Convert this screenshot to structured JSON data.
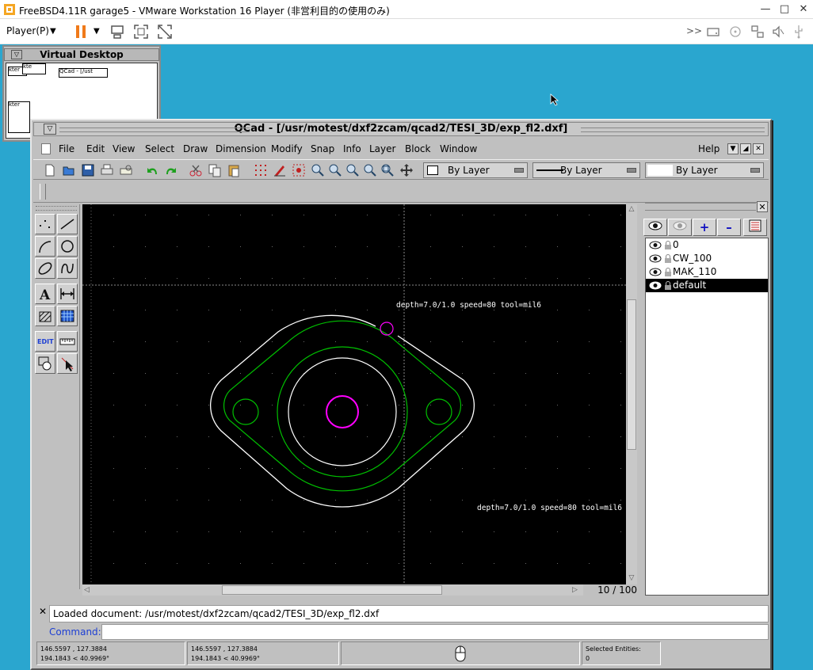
{
  "vmware": {
    "title": "FreeBSD4.11R garage5 - VMware Workstation 16 Player (非営利目的の使用のみ)",
    "player_menu": "Player(P)"
  },
  "virtual_desktop": {
    "title": "Virtual Desktop",
    "mini_windows": [
      "kter",
      "kte",
      "QCad - [/ust"
    ]
  },
  "qcad": {
    "title": "QCad - [/usr/motest/dxf2zcam/qcad2/TESI_3D/exp_fl2.dxf]",
    "menu": [
      "File",
      "Edit",
      "View",
      "Select",
      "Draw",
      "Dimension",
      "Modify",
      "Snap",
      "Info",
      "Layer",
      "Block",
      "Window"
    ],
    "help": "Help",
    "combos": {
      "color": "By Layer",
      "linetype": "By Layer",
      "width": "By Layer"
    },
    "canvas": {
      "label_top": "depth=7.0/1.0 speed=80 tool=mil6",
      "label_bottom": "depth=7.0/1.0 speed=80 tool=mil6"
    },
    "page_indicator": "10 / 100",
    "layers": [
      {
        "name": "0",
        "selected": false
      },
      {
        "name": "CW_100",
        "selected": false
      },
      {
        "name": "MAK_110",
        "selected": false
      },
      {
        "name": "default",
        "selected": true
      }
    ],
    "command_log": "Loaded document: /usr/motest/dxf2zcam/qcad2/TESI_3D/exp_fl2.dxf",
    "command_label": "Command:",
    "status": {
      "abs_coord": "146.5597 , 127.3884",
      "abs_polar": "194.1843 < 40.9969°",
      "rel_coord": "146.5597 , 127.3884",
      "rel_polar": "194.1843 < 40.9969°",
      "selected_label": "Selected Entities:",
      "selected_count": "0"
    },
    "colors": {
      "outline": "#ffffff",
      "tool_path": "#00c000",
      "hole": "#ff00ff",
      "canvas": "#000000"
    }
  }
}
